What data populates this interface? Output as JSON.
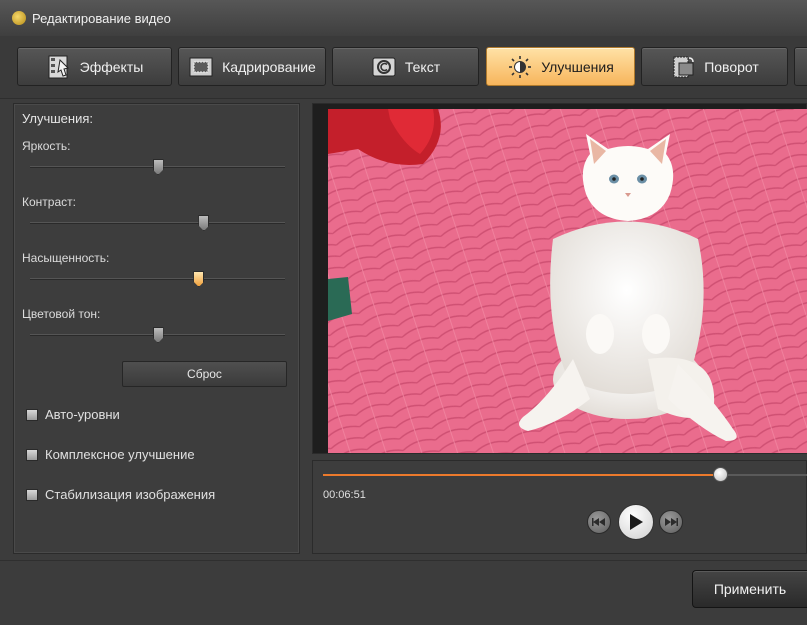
{
  "window": {
    "title": "Редактирование видео"
  },
  "tabs": [
    {
      "label": "Эффекты",
      "icon": "effects-icon",
      "active": false
    },
    {
      "label": "Кадрирование",
      "icon": "crop-icon",
      "active": false
    },
    {
      "label": "Текст",
      "icon": "text-icon",
      "active": false
    },
    {
      "label": "Улучшения",
      "icon": "enhance-icon",
      "active": true
    },
    {
      "label": "Поворот",
      "icon": "rotate-icon",
      "active": false
    }
  ],
  "enhance_panel": {
    "heading": "Улучшения:",
    "sliders": [
      {
        "label": "Яркость:",
        "value_pct": 50
      },
      {
        "label": "Контраст:",
        "value_pct": 68
      },
      {
        "label": "Насыщенность:",
        "value_pct": 66
      },
      {
        "label": "Цветовой тон:",
        "value_pct": 50
      }
    ],
    "reset_label": "Сброс",
    "checkboxes": [
      {
        "label": "Авто-уровни",
        "checked": false
      },
      {
        "label": "Комплексное улучшение",
        "checked": false
      },
      {
        "label": "Стабилизация изображения",
        "checked": false
      }
    ]
  },
  "player": {
    "time": "00:06:51",
    "progress_pct": 82,
    "accent_color": "#ec7a2c"
  },
  "footer": {
    "apply_label": "Применить"
  }
}
